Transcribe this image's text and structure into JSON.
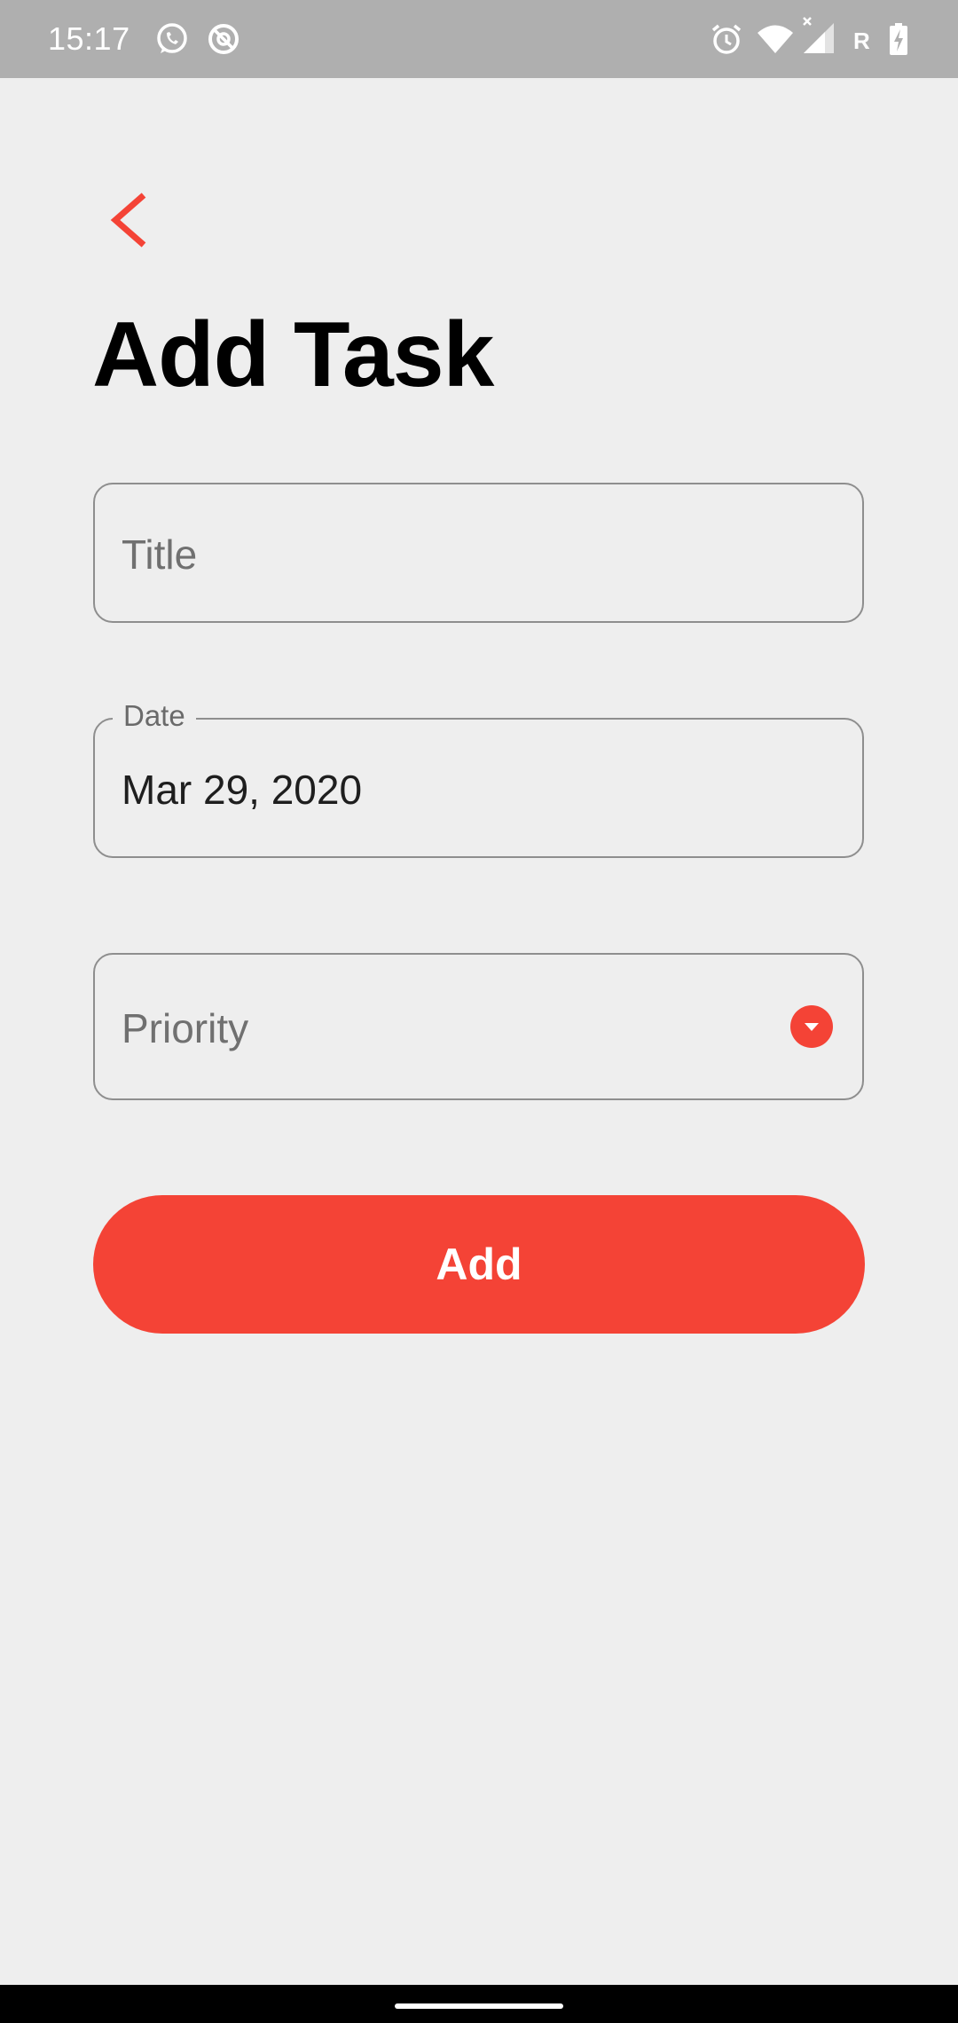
{
  "status_bar": {
    "time": "15:17",
    "network_label": "R",
    "icons": [
      "whatsapp-icon",
      "sync-icon",
      "alarm-icon",
      "wifi-icon",
      "signal-icon",
      "battery-charging-icon"
    ]
  },
  "header": {
    "back_icon": "chevron-left-icon",
    "title": "Add Task"
  },
  "form": {
    "title_field": {
      "placeholder": "Title",
      "value": ""
    },
    "date_field": {
      "label": "Date",
      "value": "Mar 29, 2020"
    },
    "priority_field": {
      "placeholder": "Priority",
      "selected": "",
      "icon": "dropdown-arrow-icon"
    },
    "add_button_label": "Add"
  },
  "colors": {
    "accent": "#f44336",
    "background": "#eeeeee",
    "status_bar": "#afafaf"
  }
}
